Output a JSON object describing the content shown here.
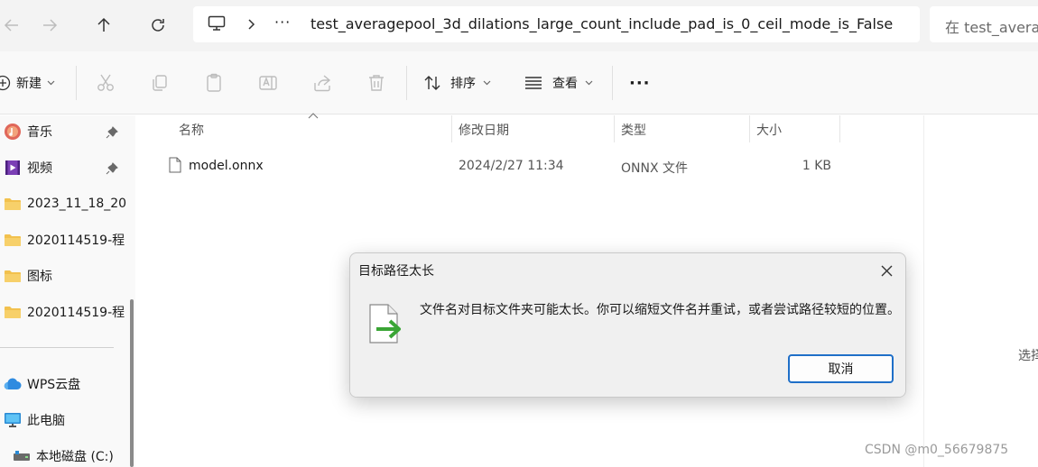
{
  "address_bar": {
    "more_label": "···",
    "path": "test_averagepool_3d_dilations_large_count_include_pad_is_0_ceil_mode_is_False",
    "search_placeholder": "在 test_averagepoo"
  },
  "toolbar": {
    "new_label": "新建",
    "sort_label": "排序",
    "view_label": "查看",
    "more_label": "···"
  },
  "sidebar": {
    "items": [
      {
        "label": "音乐",
        "icon": "music-icon",
        "pinned": true
      },
      {
        "label": "视频",
        "icon": "video-icon",
        "pinned": true
      },
      {
        "label": "2023_11_18_20",
        "icon": "folder-icon"
      },
      {
        "label": "2020114519-程",
        "icon": "folder-icon"
      },
      {
        "label": "图标",
        "icon": "folder-icon"
      },
      {
        "label": "2020114519-程",
        "icon": "folder-icon"
      }
    ],
    "items2": [
      {
        "label": "WPS云盘",
        "icon": "cloud-icon"
      },
      {
        "label": "此电脑",
        "icon": "computer-icon"
      },
      {
        "label": "本地磁盘 (C:)",
        "icon": "drive-icon"
      }
    ]
  },
  "file_list": {
    "columns": [
      "名称",
      "修改日期",
      "类型",
      "大小"
    ],
    "rows": [
      {
        "name": "model.onnx",
        "modified": "2024/2/27 11:34",
        "type": "ONNX 文件",
        "size": "1 KB"
      }
    ]
  },
  "details_pane": {
    "text": "选择"
  },
  "dialog": {
    "title": "目标路径太长",
    "message": "文件名对目标文件夹可能太长。你可以缩短文件名并重试，或者尝试路径较短的位置。",
    "cancel_label": "取消"
  },
  "watermark": "CSDN @m0_56679875",
  "colors": {
    "accent": "#1f6fc8",
    "folder": "#f2c14e",
    "arrow": "#3aa535"
  }
}
